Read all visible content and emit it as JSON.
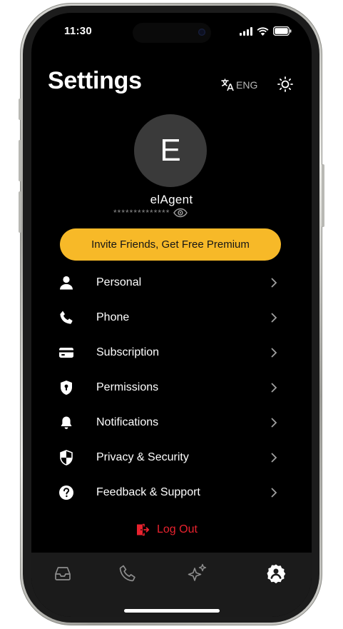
{
  "status_bar": {
    "time": "11:30",
    "icons": [
      "signal-icon",
      "wifi-icon",
      "battery-icon"
    ]
  },
  "header": {
    "title": "Settings",
    "language_label": "ENG",
    "language_icon": "translate-icon",
    "theme_icon": "sun-icon"
  },
  "profile": {
    "avatar_initial": "E",
    "username": "elAgent",
    "masked_secret": "**************",
    "reveal_icon": "eye-icon"
  },
  "invite": {
    "label": "Invite Friends, Get Free Premium",
    "color": "#f7b928"
  },
  "menu": {
    "items": [
      {
        "label": "Personal",
        "icon": "person-icon"
      },
      {
        "label": "Phone",
        "icon": "phone-icon"
      },
      {
        "label": "Subscription",
        "icon": "credit-card-icon"
      },
      {
        "label": "Permissions",
        "icon": "shield-lock-icon"
      },
      {
        "label": "Notifications",
        "icon": "bell-icon"
      },
      {
        "label": "Privacy & Security",
        "icon": "shield-half-icon"
      },
      {
        "label": "Feedback & Support",
        "icon": "question-icon"
      }
    ]
  },
  "logout": {
    "label": "Log Out",
    "icon": "logout-icon",
    "color": "#e8222e"
  },
  "tabbar": {
    "tabs": [
      {
        "icon": "inbox-icon",
        "active": false
      },
      {
        "icon": "phone-icon",
        "active": false
      },
      {
        "icon": "sparkle-icon",
        "active": false
      },
      {
        "icon": "settings-user-icon",
        "active": true
      }
    ]
  },
  "colors": {
    "background": "#000000",
    "tabbar": "#1b1b1b",
    "inactive_icon": "#8e8e8e",
    "active_icon": "#ffffff"
  }
}
